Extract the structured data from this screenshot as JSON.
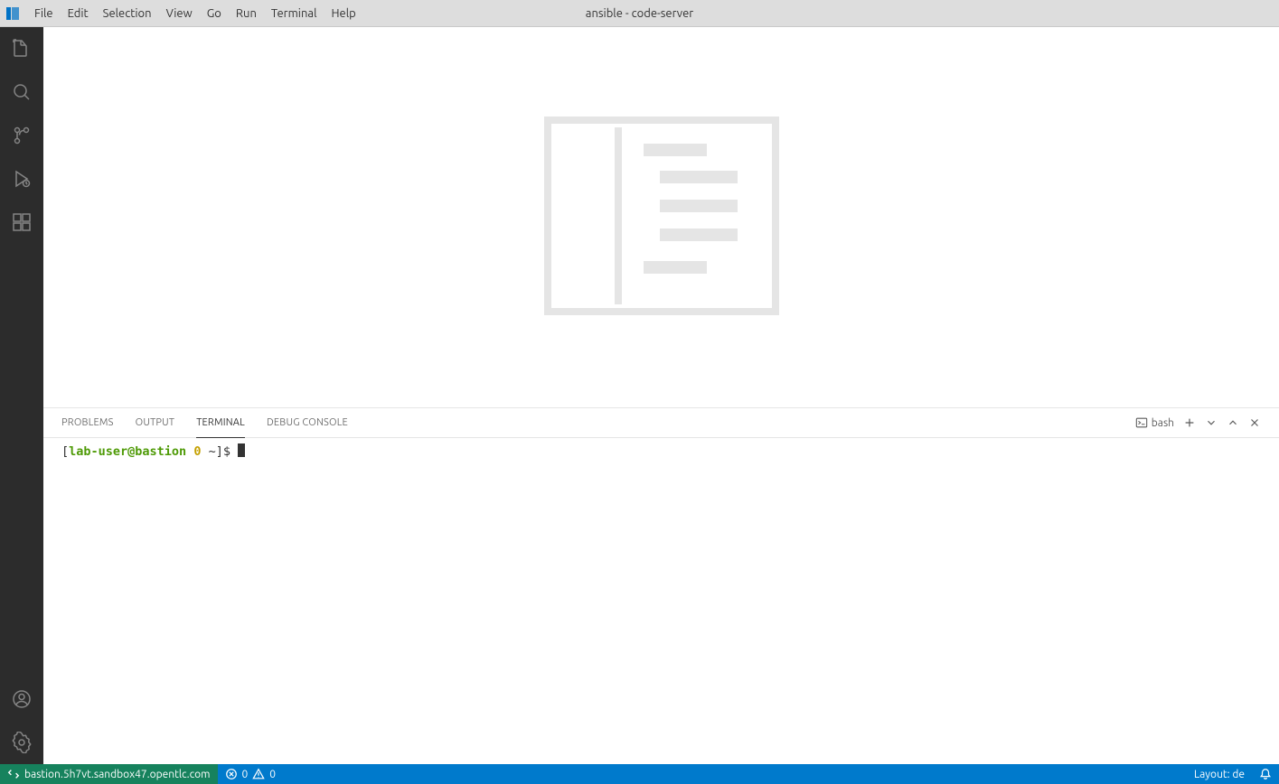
{
  "window_title": "ansible - code-server",
  "menu": {
    "items": [
      "File",
      "Edit",
      "Selection",
      "View",
      "Go",
      "Run",
      "Terminal",
      "Help"
    ]
  },
  "activity": {
    "items": [
      "explorer",
      "search",
      "source-control",
      "run-debug",
      "extensions"
    ],
    "bottom_items": [
      "accounts",
      "settings"
    ]
  },
  "panel": {
    "tabs": {
      "problems": "Problems",
      "output": "Output",
      "terminal": "Terminal",
      "debug_console": "Debug Console"
    },
    "active_tab": "terminal",
    "shell_label": "bash"
  },
  "terminal": {
    "prompt_open": "[",
    "user_host": "lab-user@bastion",
    "exit_code": "0",
    "cwd_prompt": " ~]$ "
  },
  "status": {
    "remote_host": "bastion.5h7vt.sandbox47.opentlc.com",
    "errors": "0",
    "warnings": "0",
    "layout_label": "Layout: de"
  }
}
